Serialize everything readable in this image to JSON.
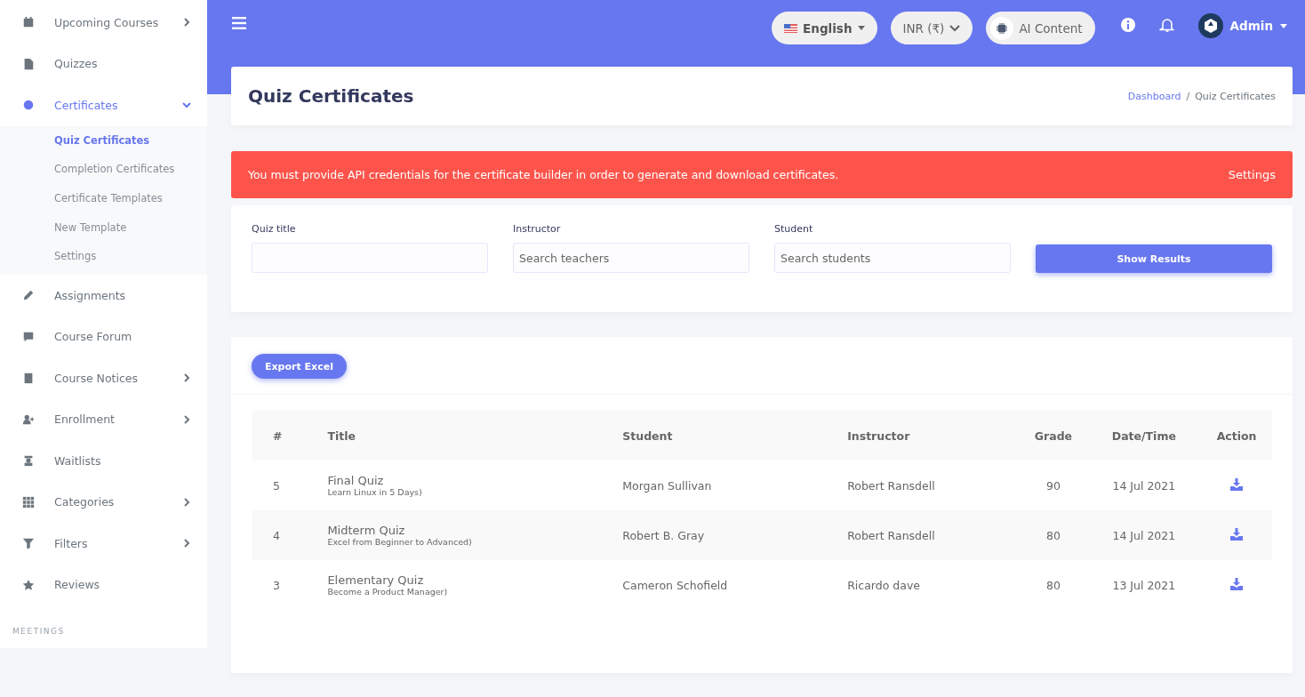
{
  "sidebar": {
    "items": [
      {
        "label": "Upcoming Courses",
        "selected": false,
        "expanded": false
      },
      {
        "label": "Quizzes",
        "selected": false
      },
      {
        "label": "Certificates",
        "selected": true,
        "expanded": true,
        "children": [
          {
            "label": "Quiz Certificates",
            "selected": true
          },
          {
            "label": "Completion Certificates",
            "selected": false
          },
          {
            "label": "Certificate Templates",
            "selected": false
          },
          {
            "label": "New Template",
            "selected": false
          },
          {
            "label": "Settings",
            "selected": false
          }
        ]
      },
      {
        "label": "Assignments",
        "selected": false
      },
      {
        "label": "Course Forum",
        "selected": false
      },
      {
        "label": "Course Notices",
        "selected": false,
        "expanded": false
      },
      {
        "label": "Enrollment",
        "selected": false,
        "expanded": false
      },
      {
        "label": "Waitlists",
        "selected": false
      },
      {
        "label": "Categories",
        "selected": false,
        "expanded": false
      },
      {
        "label": "Filters",
        "selected": false,
        "expanded": false
      },
      {
        "label": "Reviews",
        "selected": false
      }
    ],
    "section_label": "MEETINGS"
  },
  "topbar": {
    "language": "English",
    "currency": "INR (₹)",
    "ai_button": "AI Content",
    "user": "Admin"
  },
  "page_header": {
    "title": "Quiz Certificates",
    "breadcrumb": [
      "Dashboard",
      "Quiz Certificates"
    ],
    "breadcrumb_separator": "/"
  },
  "alert": {
    "message": "You must provide API credentials for the certificate builder in order to generate and download certificates.",
    "link": "Settings"
  },
  "filters": {
    "fields": [
      {
        "label": "Quiz title"
      },
      {
        "label": "Instructor",
        "placeholder": "Search teachers"
      },
      {
        "label": "Student",
        "placeholder": "Search students"
      }
    ],
    "button": "Show Results"
  },
  "export_button": "Export Excel",
  "table": {
    "columns": [
      "#",
      "Title",
      "Student",
      "Instructor",
      "Grade",
      "Date/Time",
      "Action"
    ],
    "rows": [
      {
        "number": "5",
        "title": "Final Quiz",
        "course": "Learn Linux in 5 Days)",
        "student": "Morgan Sullivan",
        "instructor": "Robert Ransdell",
        "grade": "90",
        "date": "14 Jul 2021"
      },
      {
        "number": "4",
        "title": "Midterm Quiz",
        "course": "Excel from Beginner to Advanced)",
        "student": "Robert B. Gray",
        "instructor": "Robert Ransdell",
        "grade": "80",
        "date": "14 Jul 2021"
      },
      {
        "number": "3",
        "title": "Elementary Quiz",
        "course": "Become a Product Manager)",
        "student": "Cameron Schofield",
        "instructor": "Ricardo dave",
        "grade": "80",
        "date": "13 Jul 2021"
      }
    ]
  }
}
